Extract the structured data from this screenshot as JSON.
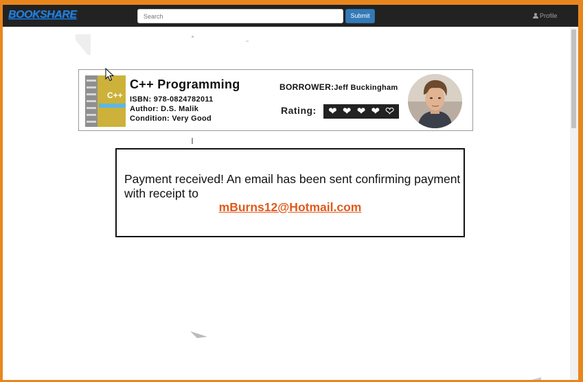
{
  "navbar": {
    "logo": "BOOKSHARE",
    "search_placeholder": "Search",
    "submit_label": "Submit",
    "profile_label": "Profile",
    "profile_icon": "user-icon"
  },
  "book": {
    "cover_text": "C++",
    "title": "C++ Programming",
    "isbn": "ISBN: 978-0824782011",
    "author": "Author: D.S. Malik",
    "condition": "Condition: Very Good",
    "borrower_label": "BORROWER:",
    "borrower_name": "Jeff Buckingham",
    "rating_label": "Rating:",
    "rating_value": 4,
    "rating_max": 5,
    "rating_icon": "heart-icon"
  },
  "message": {
    "text": "Payment received! An email has been sent confirming payment with receipt to",
    "email": "mBurns12@Hotmail.com"
  },
  "colors": {
    "frame": "#e8861d",
    "navbar": "#222222",
    "logo": "#2a7fd4",
    "submit": "#337ab7",
    "email_link": "#e05a1c"
  }
}
